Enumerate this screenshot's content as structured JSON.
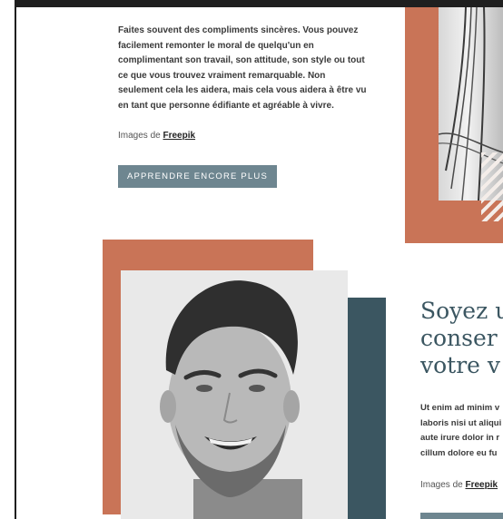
{
  "top_section": {
    "paragraph": "Faites souvent des compliments sincères. Vous pouvez facilement remonter le moral de quelqu'un en complimentant son travail, son attitude, son style ou tout ce que vous trouvez vraiment remarquable. Non seulement cela les aidera, mais cela vous aidera à être vu en tant que personne édifiante et agréable à vivre.",
    "credit_prefix": "Images de",
    "credit_link": "Freepik",
    "cta_label": "APPRENDRE ENCORE PLUS"
  },
  "lower_section": {
    "heading_lines": [
      "Soyez u",
      "conser",
      "votre v"
    ],
    "body_lines": [
      "Ut enim ad minim v",
      "laboris nisi ut aliqui",
      "aute irure dolor in r",
      "cillum dolore eu fu"
    ],
    "credit_prefix": "Images de",
    "credit_link": "Freepik"
  },
  "colors": {
    "accent_orange": "#c97457",
    "accent_navy": "#3b5661",
    "button": "#6e8690"
  }
}
